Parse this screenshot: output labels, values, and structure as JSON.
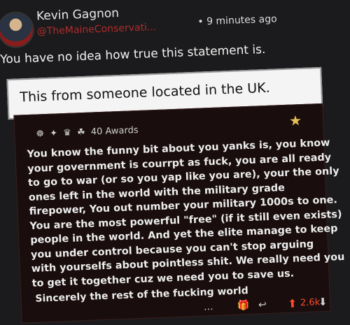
{
  "post": {
    "author": "Kevin Gagnon",
    "handle": "@TheMaineConservati...",
    "time": "• 9 minutes ago",
    "text": "You have no idea how true this statement is."
  },
  "caption": "This from someone located in the UK.",
  "comment": {
    "awards_count": "40 Awards",
    "lines": [
      "You know the funny bit about you yanks is, you know",
      "your government is courrpt as fuck, you are all ready",
      "to go to war (or so you yap like you are), your the only",
      "ones left in the world with the military grade",
      "firepower, You out number your military 1000s to one.",
      "You are the most powerful \"free\" (if it still even exists)",
      "people in the world. And yet the elite manage to keep",
      "you under control because you can't stop arguing",
      "with yourselfs about pointless shit. We really need you",
      "to get it together cuz we need you to save us."
    ],
    "signature": "Sincerely the rest of the fucking world",
    "score": "2.6k"
  },
  "actions": {
    "more": "...",
    "gift": "🎁",
    "reply": "↩",
    "upvote": "⬆",
    "downvote": "⬇"
  },
  "icons": [
    "avatar-image",
    "gold-star-icon",
    "award-icons",
    "more-icon",
    "gift-icon",
    "reply-icon",
    "upvote-icon",
    "downvote-icon"
  ],
  "colors": {
    "handle": "#b22b2b",
    "upvote": "#ff4b2b",
    "card_bg": "#190d0d"
  }
}
